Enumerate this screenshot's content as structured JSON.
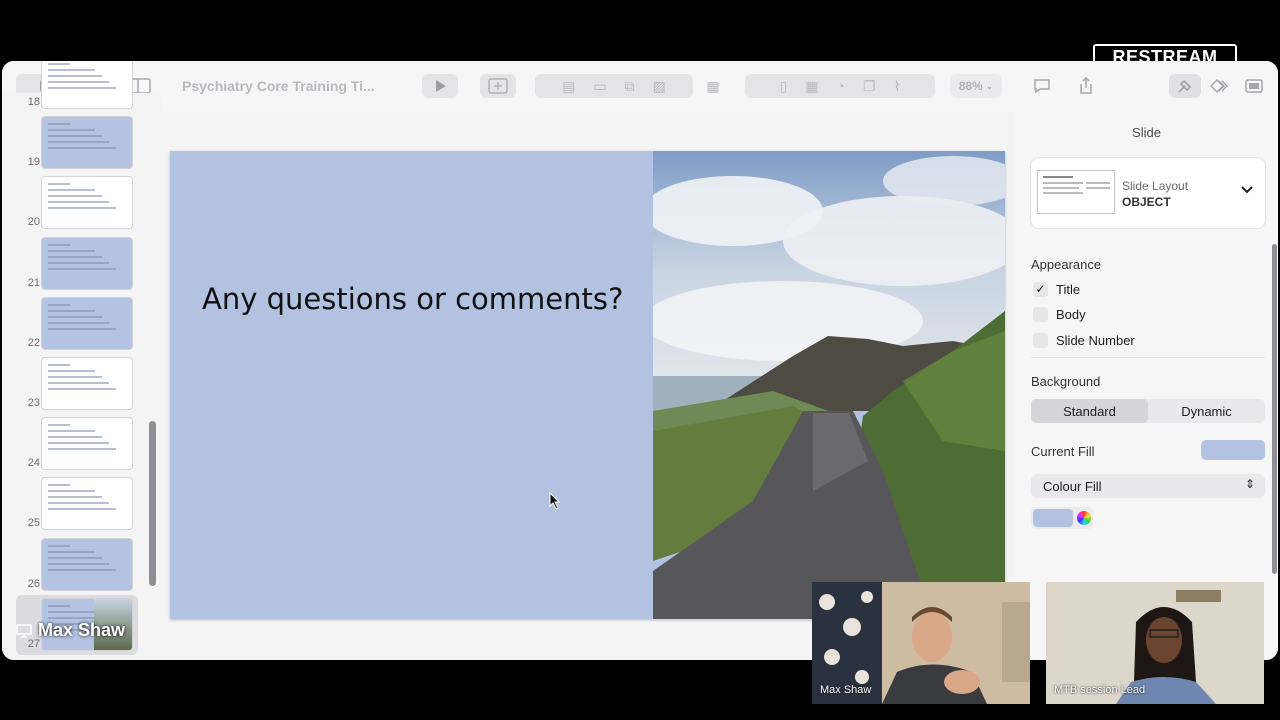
{
  "toolbar": {
    "document_title": "Psychiatry Core Training Ti...",
    "zoom": "88%",
    "icons": [
      "sidebar-toggle-icon",
      "view-icon",
      "play-icon",
      "add-slide-icon",
      "insert-icon",
      "chart-icon",
      "table-icon",
      "shape-icon",
      "media-icon",
      "comment-icon",
      "share-icon",
      "format-icon",
      "animate-icon",
      "document-icon"
    ]
  },
  "navigator": {
    "slides": [
      {
        "num": "18",
        "style": "white"
      },
      {
        "num": "19",
        "style": "blue"
      },
      {
        "num": "20",
        "style": "white"
      },
      {
        "num": "21",
        "style": "blue"
      },
      {
        "num": "22",
        "style": "blue"
      },
      {
        "num": "23",
        "style": "white"
      },
      {
        "num": "24",
        "style": "white"
      },
      {
        "num": "25",
        "style": "white"
      },
      {
        "num": "26",
        "style": "blue"
      },
      {
        "num": "27",
        "style": "blue"
      }
    ]
  },
  "slide": {
    "title": "Any questions or comments?"
  },
  "inspector": {
    "heading": "Slide",
    "layout_label": "Slide Layout",
    "layout_value": "OBJECT",
    "appearance_label": "Appearance",
    "appearance_items": [
      {
        "label": "Title",
        "checked": true
      },
      {
        "label": "Body",
        "checked": false
      },
      {
        "label": "Slide Number",
        "checked": false
      }
    ],
    "background_label": "Background",
    "background_options": [
      "Standard",
      "Dynamic"
    ],
    "background_selected": "Standard",
    "current_fill_label": "Current Fill",
    "fill_type": "Colour Fill",
    "fill_color": "#b3c2e1"
  },
  "overlay": {
    "brand": "RESTREAM",
    "speaker_name": "Max Shaw",
    "participants": [
      {
        "name": "Max Shaw"
      },
      {
        "name": "MTB session Lead"
      }
    ]
  }
}
